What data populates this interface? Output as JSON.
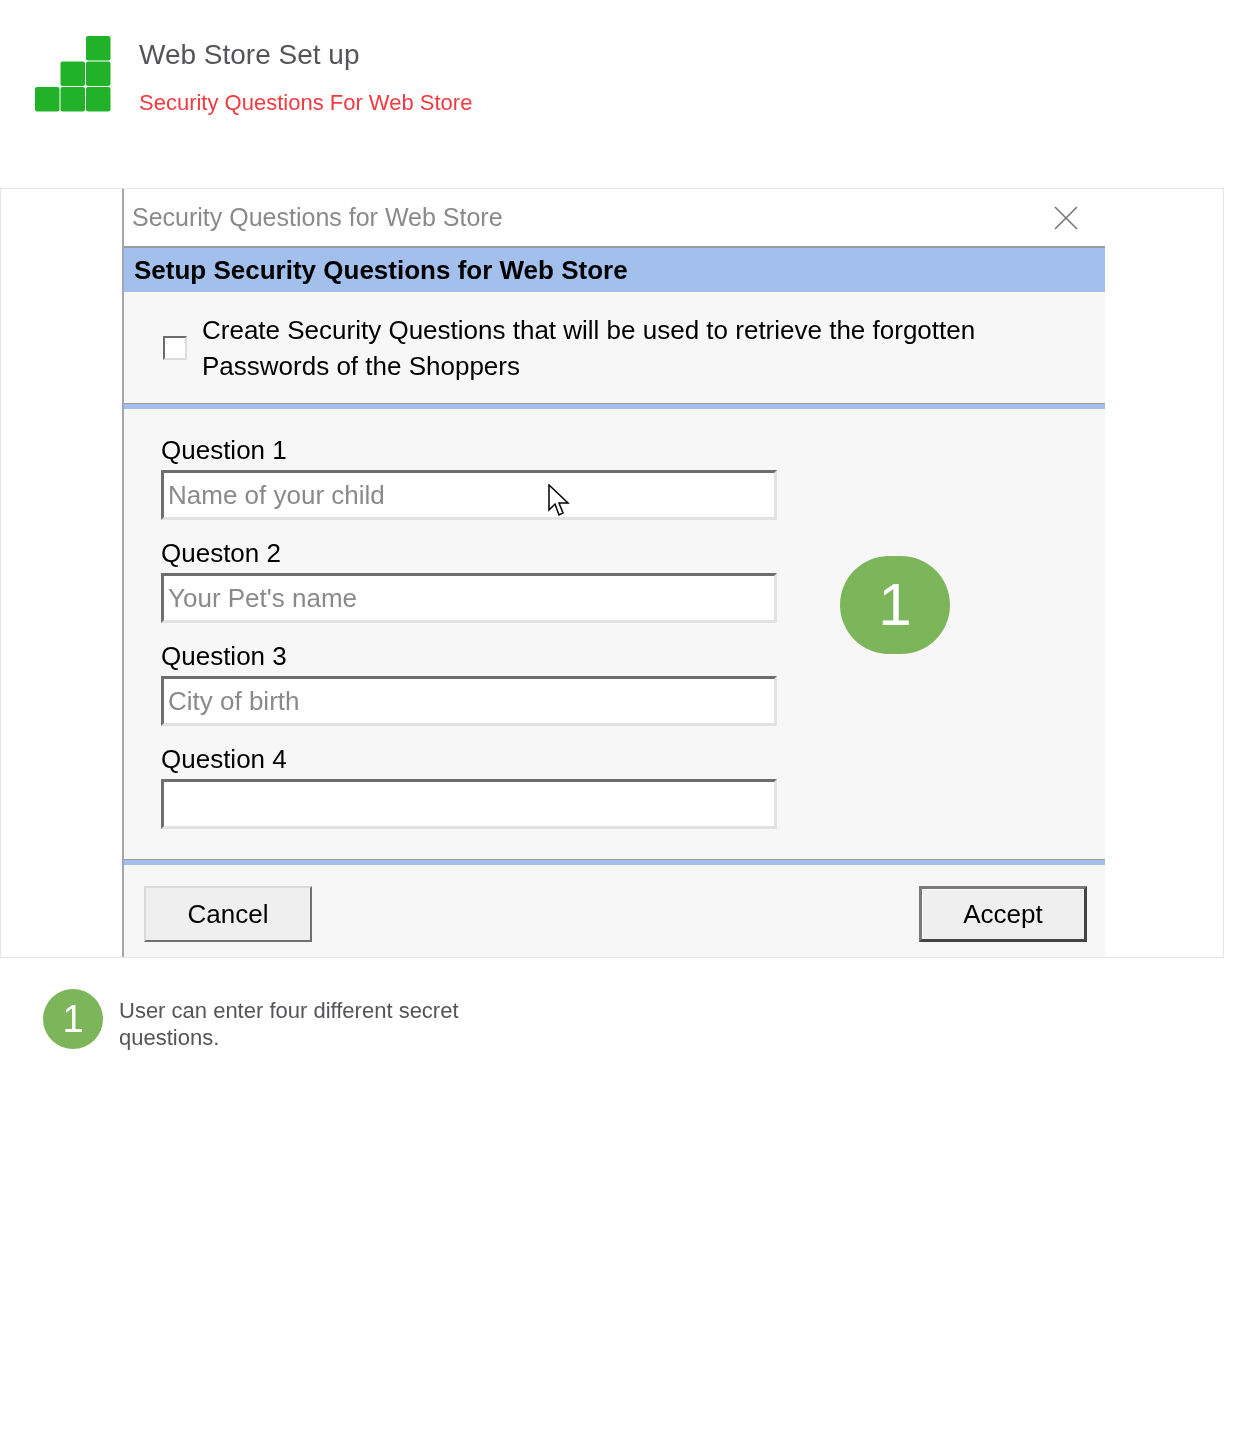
{
  "header": {
    "title": "Web Store Set up",
    "subtitle": "Security Questions For Web Store"
  },
  "dialog": {
    "title": "Security Questions for Web Store",
    "heading": "Setup Security Questions for Web Store",
    "option": {
      "label": "Create Security Questions that will be used to retrieve the forgotten Passwords of the Shoppers",
      "checked": false
    },
    "questions": [
      {
        "label": "Question 1",
        "placeholder": "Name of your child"
      },
      {
        "label": "Queston 2",
        "placeholder": "Your Pet's name"
      },
      {
        "label": "Question 3",
        "placeholder": "City of birth"
      },
      {
        "label": "Question 4"
      }
    ],
    "callout": "1",
    "buttons": [
      {
        "label": "Cancel",
        "default": false
      },
      {
        "label": "Accept",
        "default": true
      }
    ]
  },
  "notes": [
    {
      "number": "1",
      "text": "User can enter four different secret questions."
    }
  ]
}
